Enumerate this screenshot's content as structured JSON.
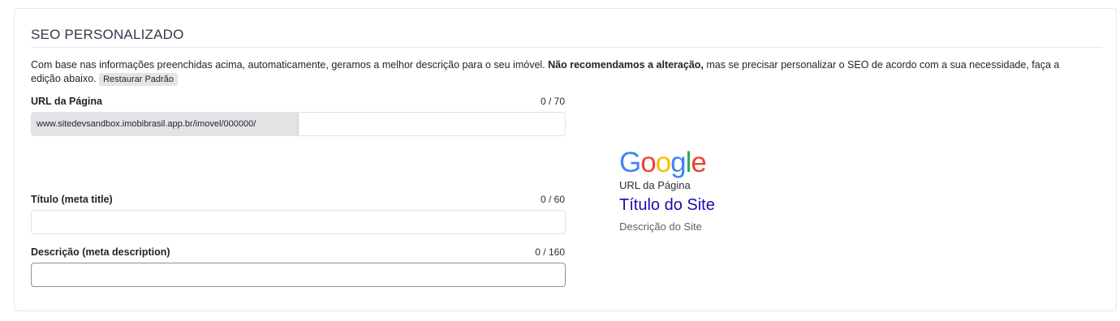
{
  "section": {
    "title": "SEO PERSONALIZADO",
    "intro_text_1": "Com base nas informações preenchidas acima, automaticamente, geramos a melhor descrição para o seu imóvel.",
    "intro_bold": "Não recomendamos a alteração,",
    "intro_text_2": "mas se precisar personalizar o SEO de acordo com a sua necessidade, faça a edição abaixo.",
    "restore_button": "Restaurar Padrão"
  },
  "fields": {
    "url": {
      "label": "URL da Página",
      "counter": "0 / 70",
      "prefix": "www.sitedevsandbox.imobibrasil.app.br/imovel/000000/",
      "value": ""
    },
    "title": {
      "label": "Título (meta title)",
      "counter": "0 / 60",
      "value": ""
    },
    "description": {
      "label": "Descrição (meta description)",
      "counter": "0 / 160",
      "value": ""
    }
  },
  "preview": {
    "logo_letters": [
      "G",
      "o",
      "o",
      "g",
      "l",
      "e"
    ],
    "url": "URL da Página",
    "title": "Título do Site",
    "description": "Descrição do Site"
  },
  "colors": {
    "google_blue": "#4285f4",
    "google_red": "#ea4335",
    "google_yellow": "#fbbc05",
    "google_green": "#34a853",
    "link_title": "#1a0dab"
  }
}
